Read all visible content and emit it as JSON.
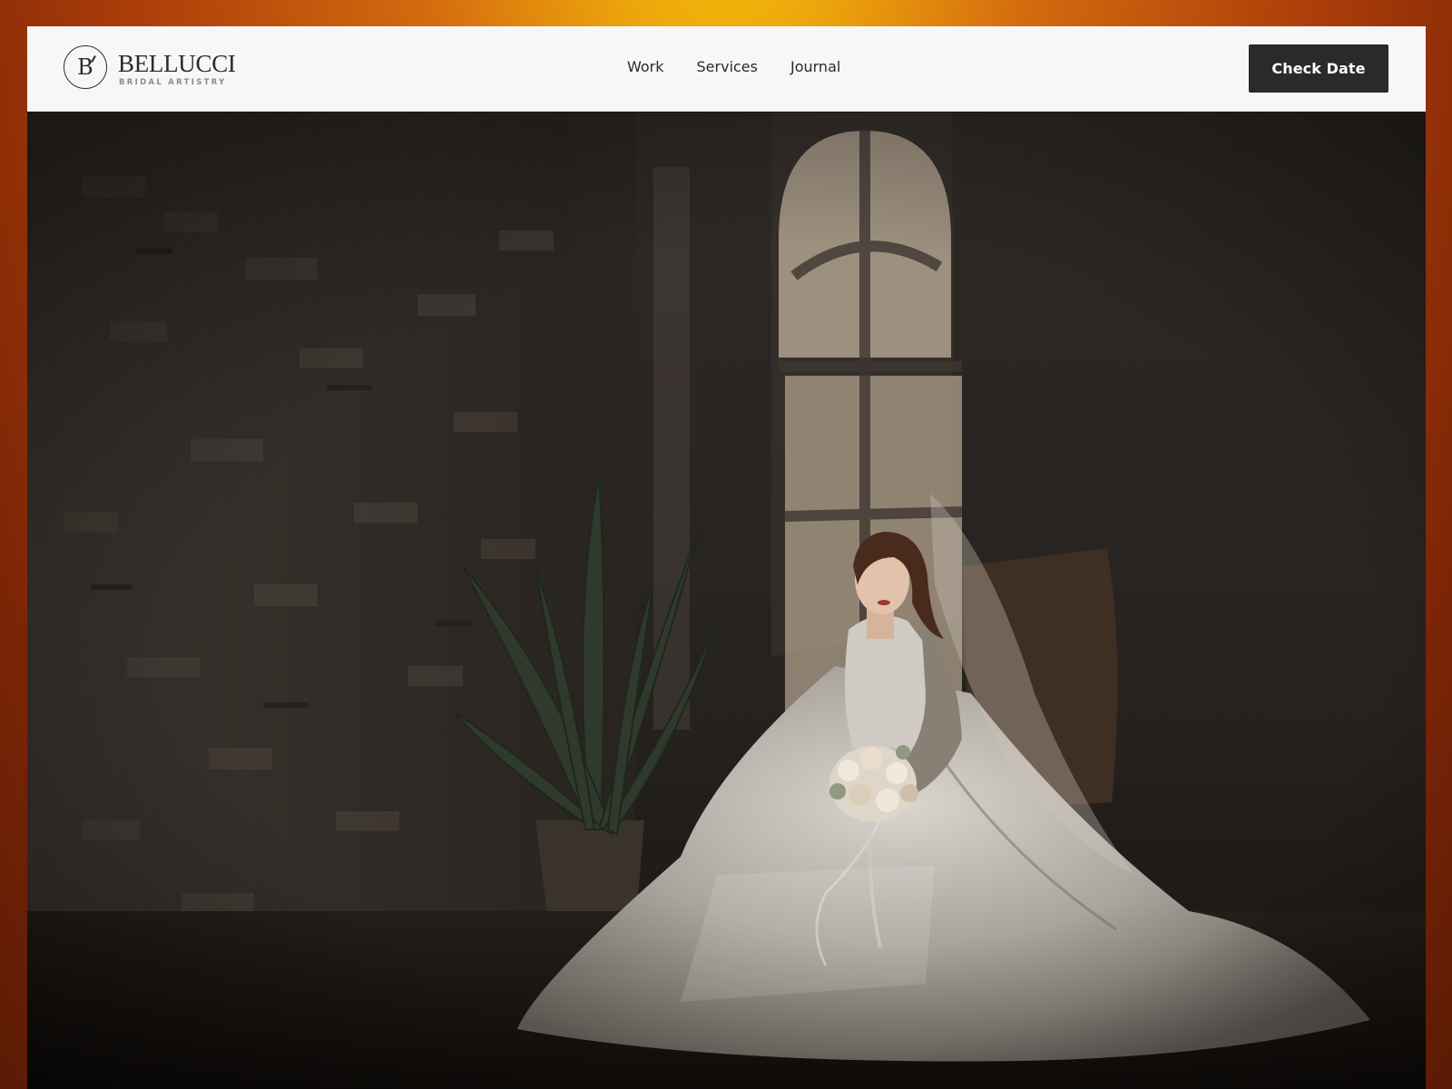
{
  "brand": {
    "mark_letter": "B",
    "name": "BELLUCCI",
    "tagline": "BRIDAL ARTISTRY"
  },
  "nav": {
    "links": [
      {
        "label": "Work"
      },
      {
        "label": "Services"
      },
      {
        "label": "Journal"
      }
    ],
    "cta_label": "Check Date"
  },
  "colors": {
    "navbar_bg": "#f7f7f8",
    "cta_bg": "#2a2a2a",
    "cta_text": "#ffffff",
    "backdrop_top": "#f6c209",
    "backdrop_edge": "#7e2606"
  },
  "hero": {
    "image_subject": "Bride in white gown seated by arched window holding bouquet, plant and brick wall in dim room"
  }
}
